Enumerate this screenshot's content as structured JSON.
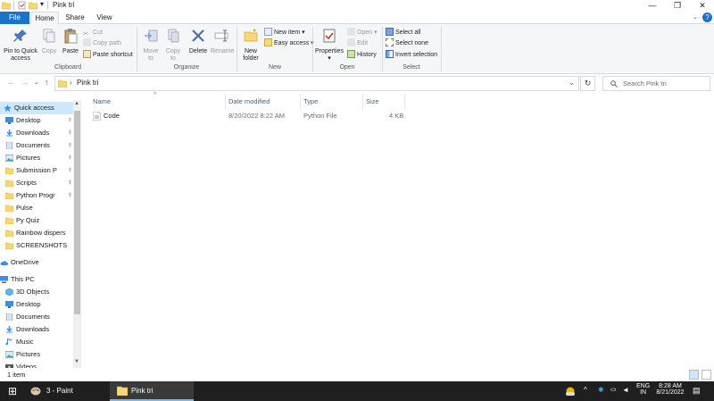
{
  "titlebar": {
    "title": "Pink tri",
    "minimize": "—",
    "maximize": "❐",
    "close": "✕",
    "qa_dropdown": "▾"
  },
  "tabs": {
    "file": "File",
    "home": "Home",
    "share": "Share",
    "view": "View",
    "help": "?",
    "collapse": "⌄"
  },
  "ribbon": {
    "clipboard": {
      "label": "Clipboard",
      "pin": "Pin to Quick",
      "pin2": "access",
      "copy": "Copy",
      "paste": "Paste",
      "cut": "Cut",
      "copy_path": "Copy path",
      "paste_shortcut": "Paste shortcut"
    },
    "organize": {
      "label": "Organize",
      "move_to": "Move",
      "move_to2": "to",
      "copy_to": "Copy",
      "copy_to2": "to",
      "delete": "Delete",
      "rename": "Rename"
    },
    "new": {
      "label": "New",
      "new_folder": "New",
      "new_folder2": "folder",
      "new_item": "New item",
      "easy_access": "Easy access"
    },
    "open": {
      "label": "Open",
      "properties": "Properties",
      "open": "Open",
      "edit": "Edit",
      "history": "History"
    },
    "select": {
      "label": "Select",
      "select_all": "Select all",
      "select_none": "Select none",
      "invert": "Invert selection"
    }
  },
  "nav": {
    "back": "←",
    "forward": "→",
    "recent": "⌄",
    "up": "↑"
  },
  "address": {
    "sep": "›",
    "path": "Pink tri",
    "dropdown": "⌄",
    "refresh": "↻"
  },
  "search": {
    "placeholder": "Search Pink tri"
  },
  "navpane": {
    "items": [
      {
        "label": "Quick access",
        "pinned": false
      },
      {
        "label": "Desktop",
        "pinned": true
      },
      {
        "label": "Downloads",
        "pinned": true
      },
      {
        "label": "Documents",
        "pinned": true
      },
      {
        "label": "Pictures",
        "pinned": true
      },
      {
        "label": "Submission P",
        "pinned": true
      },
      {
        "label": "Scripts",
        "pinned": true
      },
      {
        "label": "Python Progr",
        "pinned": true
      },
      {
        "label": "Pulse",
        "pinned": false
      },
      {
        "label": "Py Quiz",
        "pinned": false
      },
      {
        "label": "Rainbow dispers",
        "pinned": false
      },
      {
        "label": "SCREENSHOTS",
        "pinned": false
      },
      {
        "label": "OneDrive",
        "pinned": false
      },
      {
        "label": "This PC",
        "pinned": false
      },
      {
        "label": "3D Objects",
        "pinned": false
      },
      {
        "label": "Desktop",
        "pinned": false
      },
      {
        "label": "Documents",
        "pinned": false
      },
      {
        "label": "Downloads",
        "pinned": false
      },
      {
        "label": "Music",
        "pinned": false
      },
      {
        "label": "Pictures",
        "pinned": false
      },
      {
        "label": "Videos",
        "pinned": false
      }
    ],
    "pin_glyph": "📌"
  },
  "columns": {
    "name": "Name",
    "date": "Date modified",
    "type": "Type",
    "size": "Size",
    "sort_indicator": "^"
  },
  "files": [
    {
      "name": "Code",
      "date": "8/20/2022 8:22 AM",
      "type": "Python File",
      "size": "4 KB"
    }
  ],
  "status": {
    "count": "1 item"
  },
  "taskbar": {
    "start": "⊞",
    "paint": "3 - Paint",
    "explorer": "Pink tri",
    "lang1": "ENG",
    "lang2": "IN",
    "time": "8:28 AM",
    "date": "8/21/2022",
    "chevron": "^"
  },
  "colors": {
    "accent": "#1a73c9",
    "folder": "#f8d775",
    "selected": "#cce8ff"
  }
}
